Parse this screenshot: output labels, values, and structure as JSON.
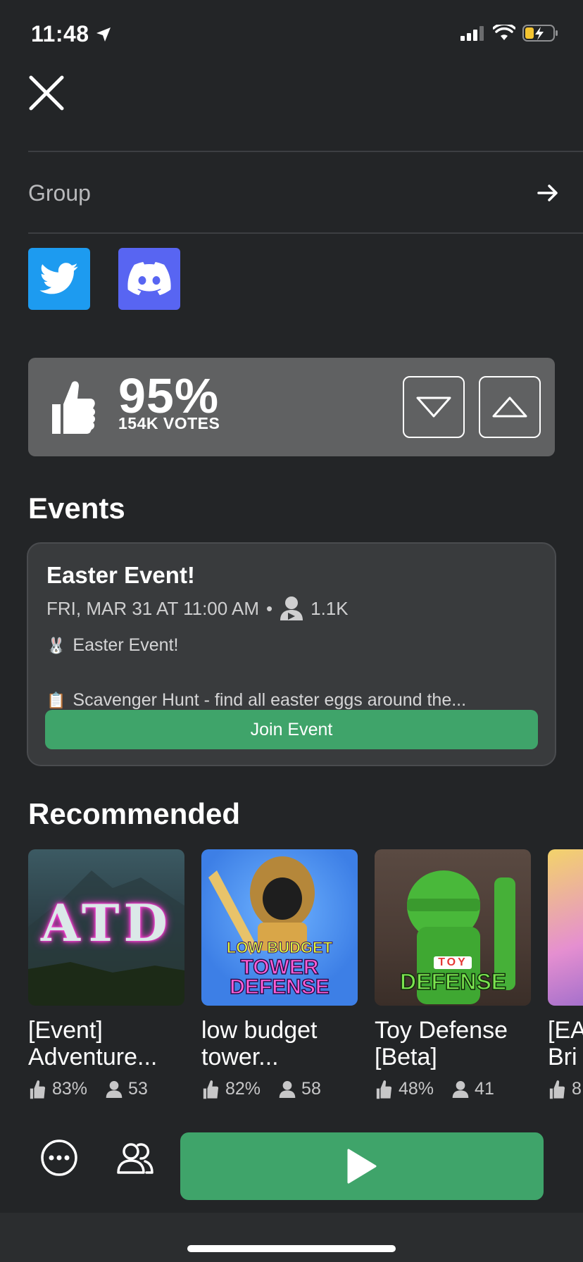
{
  "status_bar": {
    "time": "11:48"
  },
  "header": {
    "group_label": "Group"
  },
  "social": {
    "twitter": "Twitter",
    "discord": "Discord"
  },
  "votes": {
    "percent": "95%",
    "count": "154K VOTES"
  },
  "events": {
    "heading": "Events",
    "card": {
      "title": "Easter Event!",
      "date": "FRI, MAR 31 AT 11:00 AM",
      "separator": "•",
      "attendees": "1.1K",
      "line1": "Easter Event!",
      "line2": "Scavenger Hunt - find all easter eggs around the...",
      "join_label": "Join Event"
    }
  },
  "recommended": {
    "heading": "Recommended",
    "items": [
      {
        "name1": "[Event]",
        "name2": "Adventure...",
        "rating": "83%",
        "players": "53",
        "thumb_text": "ATD"
      },
      {
        "name1": "low budget",
        "name2": "tower...",
        "rating": "82%",
        "players": "58",
        "thumb_text1": "LOW BUDGET",
        "thumb_text2": "TOWER",
        "thumb_text3": "DEFENSE"
      },
      {
        "name1": "Toy Defense",
        "name2": "[Beta]",
        "rating": "48%",
        "players": "41",
        "thumb_text1": "TOY",
        "thumb_text2": "DEFENSE"
      },
      {
        "name1": "[EA",
        "name2": "Bri",
        "rating": "8"
      }
    ]
  },
  "colors": {
    "green": "#3fa46a",
    "twitter": "#1d9bf0",
    "discord": "#5865f2",
    "background": "#232527"
  }
}
